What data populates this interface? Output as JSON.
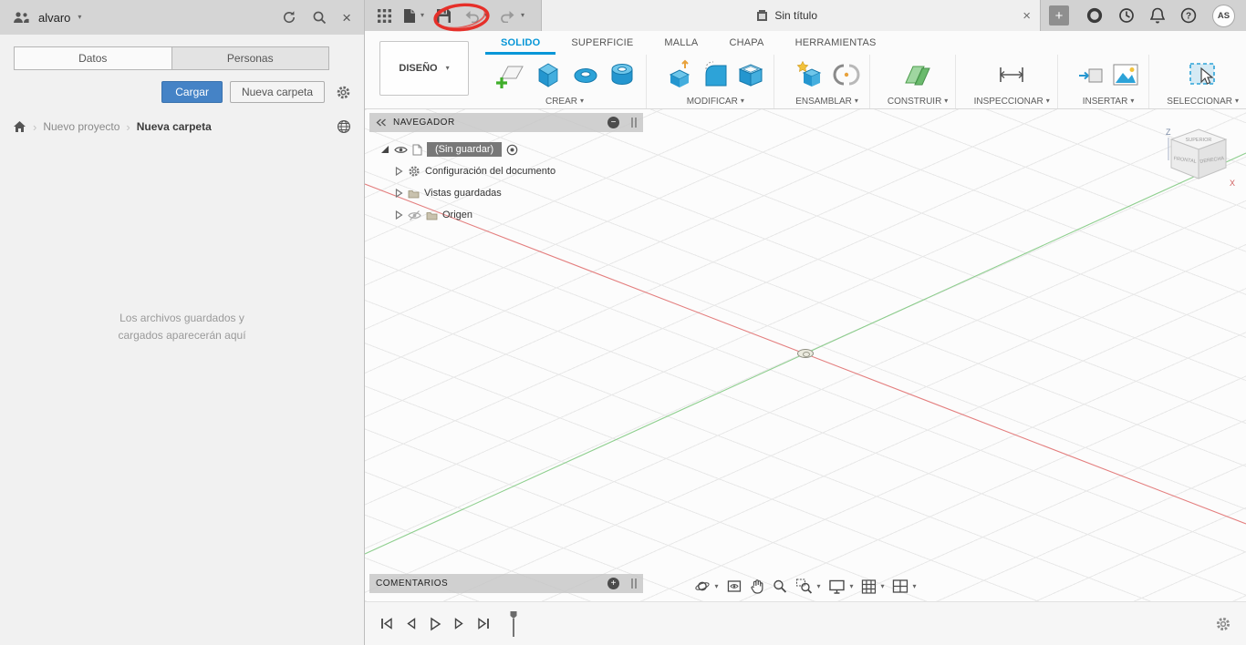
{
  "colors": {
    "accent_blue": "#0696d7",
    "upload_button_blue": "#4583c6",
    "topbar_gray": "#d2d2d2",
    "axis_x_red": "#e06a6a",
    "axis_y_green": "#7cc87c",
    "annotation_red": "#e6302a"
  },
  "icons": {
    "caret": "▾",
    "close": "×",
    "plus": "+",
    "minus": "−",
    "chevron": "›",
    "help": "?"
  },
  "data_panel": {
    "user": "alvaro",
    "tab_datos": "Datos",
    "tab_personas": "Personas",
    "upload_button": "Cargar",
    "new_folder_button": "Nueva carpeta",
    "breadcrumb_project": "Nuevo proyecto",
    "breadcrumb_folder": "Nueva carpeta",
    "empty_line1": "Los archivos guardados y",
    "empty_line2": "cargados aparecerán aquí"
  },
  "titlebar": {
    "document_tab_title": "Sin título",
    "avatar_initials": "AS"
  },
  "ribbon": {
    "workspace_label": "DISEÑO",
    "active_tab": "SOLIDO",
    "tabs": [
      "SOLIDO",
      "SUPERFICIE",
      "MALLA",
      "CHAPA",
      "HERRAMIENTAS"
    ],
    "groups": [
      "CREAR",
      "MODIFICAR",
      "ENSAMBLAR",
      "CONSTRUIR",
      "INSPECCIONAR",
      "INSERTAR",
      "SELECCIONAR"
    ]
  },
  "navigator": {
    "title": "NAVEGADOR",
    "root_label": "(Sin guardar)",
    "items": [
      "Configuración del documento",
      "Vistas guardadas",
      "Origen"
    ]
  },
  "comments": {
    "title": "COMENTARIOS"
  },
  "viewcube": {
    "z_axis": "Z",
    "x_axis": "X",
    "face_top": "SUPERIOR",
    "face_front": "FRONTAL",
    "face_right": "DERECHA"
  }
}
